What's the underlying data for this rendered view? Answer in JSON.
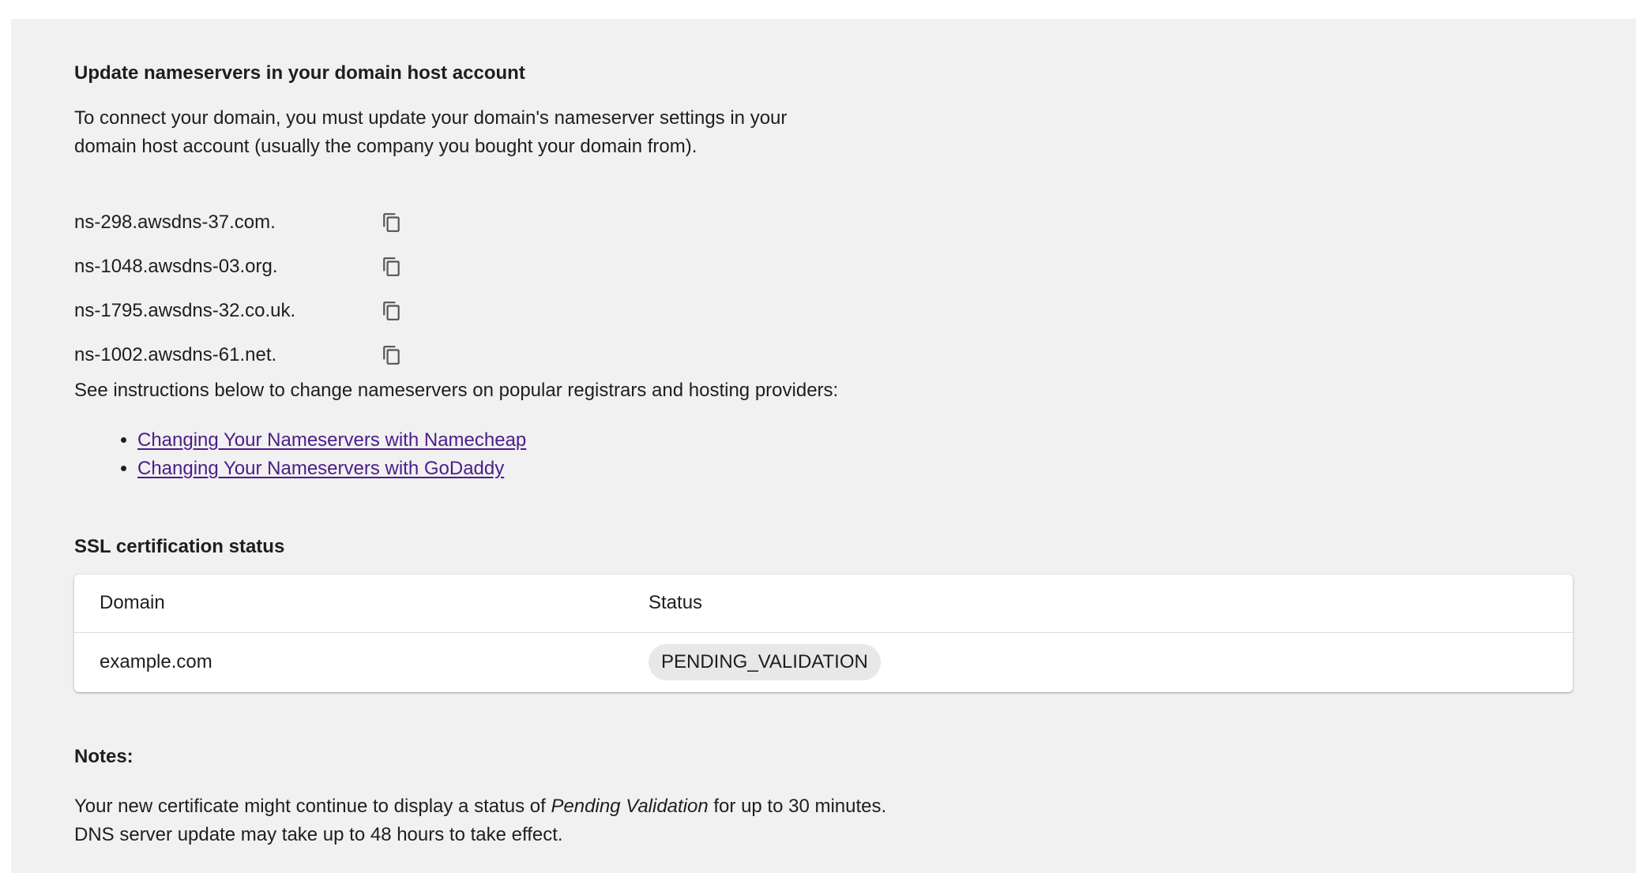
{
  "nameservers_section": {
    "title": "Update nameservers in your domain host account",
    "intro_line1": "To connect your domain, you must update your domain's nameserver settings in your",
    "intro_line2": "domain host account (usually the company you bought your domain from).",
    "nameservers": [
      "ns-298.awsdns-37.com.",
      "ns-1048.awsdns-03.org.",
      "ns-1795.awsdns-32.co.uk.",
      "ns-1002.awsdns-61.net."
    ],
    "copy_icon": "copy-icon",
    "instructions": "See instructions below to change nameservers on popular registrars and hosting providers:",
    "links": [
      "Changing Your Nameservers with Namecheap",
      "Changing Your Nameservers with GoDaddy"
    ],
    "link_color": "#4a1d8a"
  },
  "ssl_section": {
    "title": "SSL certification status",
    "columns": [
      "Domain",
      "Status"
    ],
    "rows": [
      {
        "domain": "example.com",
        "status": "PENDING_VALIDATION"
      }
    ]
  },
  "notes_section": {
    "title": "Notes:",
    "line1_prefix": "Your new certificate might continue to display a status of ",
    "line1_emphasis": "Pending Validation",
    "line1_suffix": " for up to 30 minutes.",
    "line2": "DNS server update may take up to 48 hours to take effect."
  }
}
